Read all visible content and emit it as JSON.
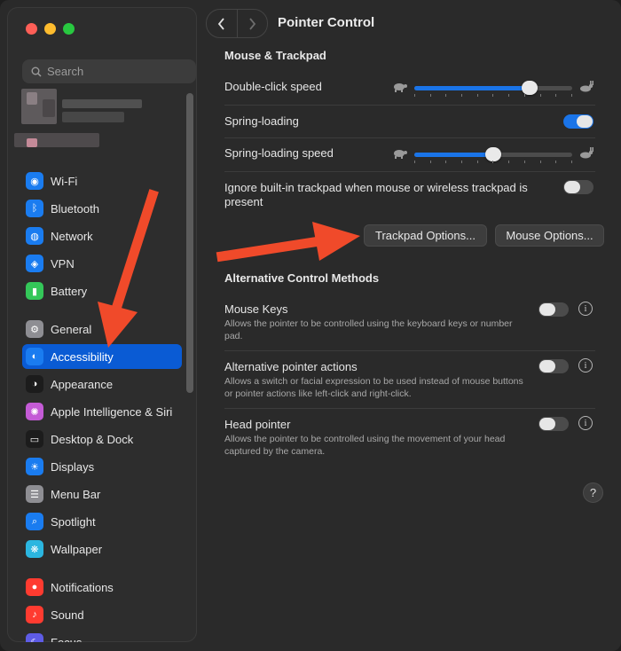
{
  "window": {
    "title": "Pointer Control"
  },
  "search": {
    "placeholder": "Search"
  },
  "sidebar": {
    "items": [
      {
        "label": "Wi-Fi",
        "icon": "wifi-icon",
        "color": "#1a7cf0"
      },
      {
        "label": "Bluetooth",
        "icon": "bluetooth-icon",
        "color": "#1a7cf0"
      },
      {
        "label": "Network",
        "icon": "network-icon",
        "color": "#1a7cf0"
      },
      {
        "label": "VPN",
        "icon": "vpn-icon",
        "color": "#1a7cf0"
      },
      {
        "label": "Battery",
        "icon": "battery-icon",
        "color": "#34c759"
      },
      {
        "label": "General",
        "icon": "gear-icon",
        "color": "#8e8e93"
      },
      {
        "label": "Accessibility",
        "icon": "accessibility-icon",
        "color": "#1a7cf0",
        "active": true
      },
      {
        "label": "Appearance",
        "icon": "appearance-icon",
        "color": "#1c1c1c"
      },
      {
        "label": "Apple Intelligence & Siri",
        "icon": "siri-icon",
        "color": "#c45bd6"
      },
      {
        "label": "Desktop & Dock",
        "icon": "dock-icon",
        "color": "#1c1c1c"
      },
      {
        "label": "Displays",
        "icon": "displays-icon",
        "color": "#1a7cf0"
      },
      {
        "label": "Menu Bar",
        "icon": "menubar-icon",
        "color": "#8e8e93"
      },
      {
        "label": "Spotlight",
        "icon": "spotlight-icon",
        "color": "#1a7cf0"
      },
      {
        "label": "Wallpaper",
        "icon": "wallpaper-icon",
        "color": "#2bb6e0"
      },
      {
        "label": "Notifications",
        "icon": "notifications-icon",
        "color": "#ff3b30"
      },
      {
        "label": "Sound",
        "icon": "sound-icon",
        "color": "#ff3b30"
      },
      {
        "label": "Focus",
        "icon": "focus-icon",
        "color": "#5e5ce6"
      }
    ]
  },
  "sections": {
    "mouse_trackpad": {
      "title": "Mouse & Trackpad",
      "double_click_speed": {
        "label": "Double-click speed",
        "value": 0.73
      },
      "spring_loading": {
        "label": "Spring-loading",
        "on": true
      },
      "spring_loading_speed": {
        "label": "Spring-loading speed",
        "value": 0.5
      },
      "ignore_trackpad": {
        "label": "Ignore built-in trackpad when mouse or wireless trackpad is present",
        "on": false
      },
      "trackpad_options_button": "Trackpad Options...",
      "mouse_options_button": "Mouse Options..."
    },
    "alt_control": {
      "title": "Alternative Control Methods",
      "mouse_keys": {
        "label": "Mouse Keys",
        "desc": "Allows the pointer to be controlled using the keyboard keys or number pad.",
        "on": false
      },
      "alt_pointer": {
        "label": "Alternative pointer actions",
        "desc": "Allows a switch or facial expression to be used instead of mouse buttons or pointer actions like left-click and right-click.",
        "on": false
      },
      "head_pointer": {
        "label": "Head pointer",
        "desc": "Allows the pointer to be controlled using the movement of your head captured by the camera.",
        "on": false
      }
    }
  },
  "help_label": "?",
  "colors": {
    "accent": "#1a74e8",
    "annotation_arrow": "#f04a2a"
  }
}
